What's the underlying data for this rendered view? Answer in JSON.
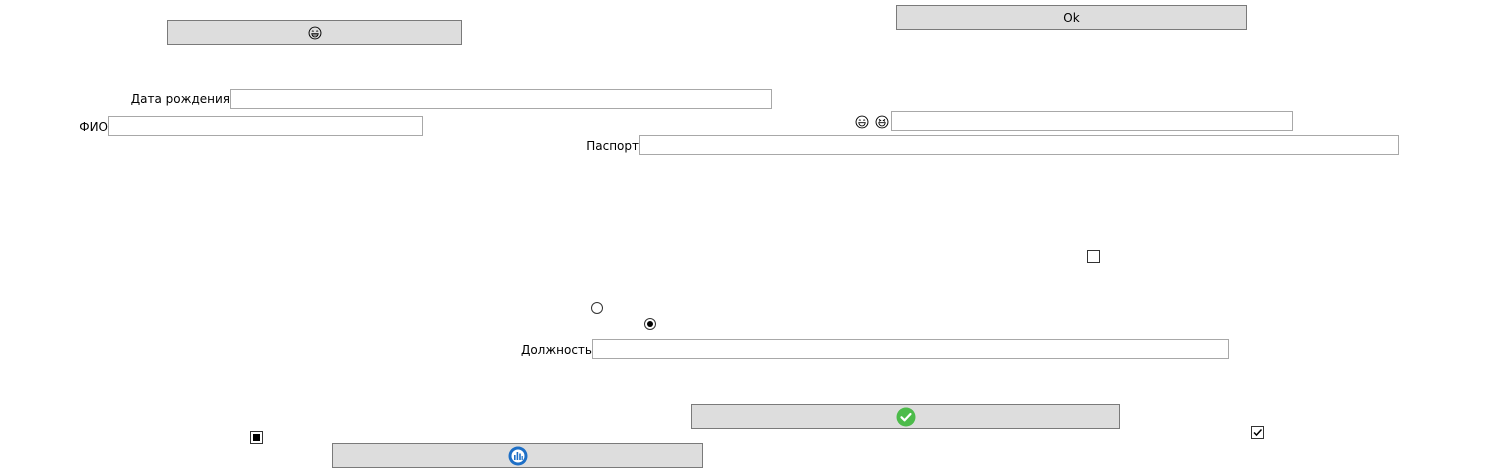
{
  "buttons": {
    "ok_label": "Ok",
    "emoji_button_icon": "laughing-face-icon",
    "check_button_icon": "green-check-circle-icon",
    "chart_button_icon": "blue-chart-circle-icon"
  },
  "form": {
    "birth_date_label": "Дата рождения",
    "birth_date_value": "",
    "fio_label": "ФИО",
    "fio_value": "",
    "emoji_field_value": "",
    "passport_label": "Паспорт",
    "passport_value": "",
    "position_label": "Должность",
    "position_value": ""
  },
  "controls": {
    "checkbox_top_checked": false,
    "checkbox_bottom_checked": true,
    "checkbox_indeterminate": true,
    "radio_1_selected": false,
    "radio_2_selected": true
  },
  "colors": {
    "button_bg": "#dddddd",
    "check_green": "#4cbb4a",
    "chart_blue": "#1e6fc6"
  }
}
